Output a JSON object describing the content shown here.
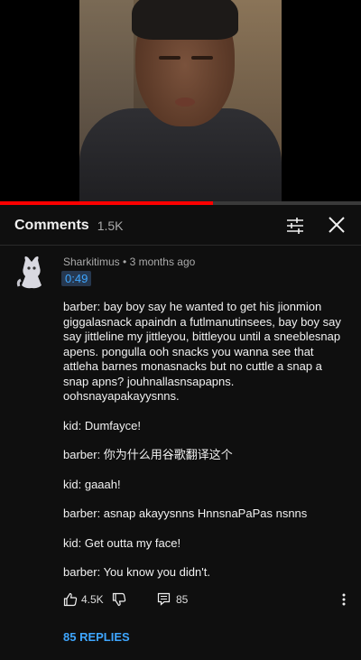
{
  "video": {
    "progress_fraction": 0.59
  },
  "header": {
    "title": "Comments",
    "count": "1.5K"
  },
  "comment": {
    "author": "Sharkitimus",
    "separator": "•",
    "age": "3 months ago",
    "timestamp": "0:49",
    "paragraphs": [
      "barber: bay boy say he wanted to get his jionmion giggalasnack apaindn a futlmanutinsees, bay boy say say jittleline my jittleyou, bittleyou until a sneeblesnap apens. pongulla ooh snacks you wanna see that attleha barnes monasnacks but no cuttle a snap a snap apns? jouhnallasnsapapns. oohsnayapakayysnns.",
      "kid: Dumfayce!",
      "barber: 你为什么用谷歌翻译这个",
      "kid: gaaah!",
      "barber: asnap akayysnns HnnsnaPaPas nsnns",
      "kid: Get outta my face!",
      "barber: You know you didn't."
    ],
    "likes": "4.5K",
    "reply_count": "85",
    "replies_label": "85 REPLIES"
  },
  "colors": {
    "accent": "#3ea6ff",
    "progress": "#ff0000",
    "background": "#0f0f0f"
  }
}
